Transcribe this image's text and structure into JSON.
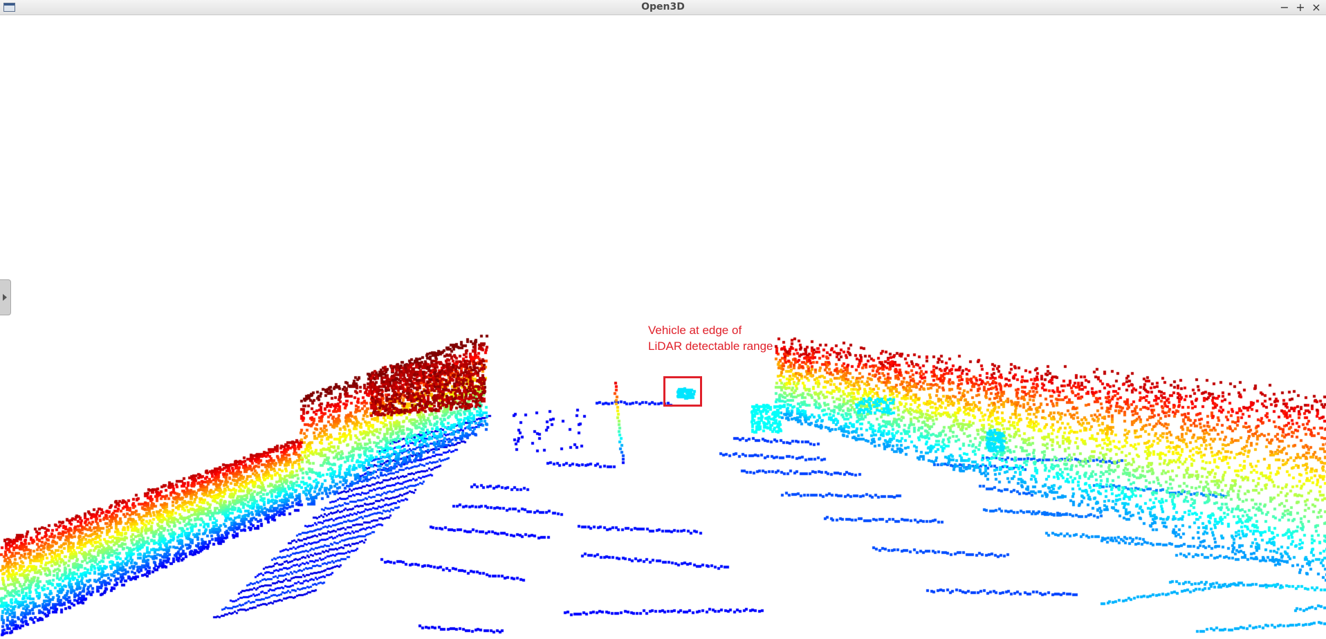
{
  "window": {
    "title": "Open3D",
    "minimize": "−",
    "maximize": "+",
    "close": "×"
  },
  "annotation": {
    "line1": "Vehicle at edge of",
    "line2": "LiDAR detectable range",
    "color": "#e0202a"
  },
  "colormap": "jet",
  "background": "#ffffff",
  "icons": [
    "app-window-icon",
    "panel-expand-arrow-icon"
  ]
}
